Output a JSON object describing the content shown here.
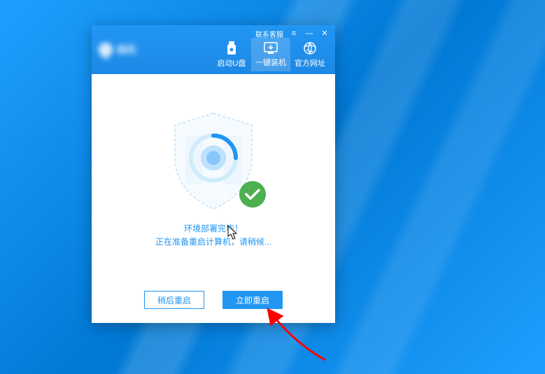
{
  "titlebar": {
    "contact_label": "联系客服"
  },
  "tabs": {
    "usb": "启动U盘",
    "install": "一键装机",
    "website": "官方网址"
  },
  "status": {
    "line1": "环境部署完毕！",
    "line2": "正在准备重启计算机，请稍候..."
  },
  "buttons": {
    "later": "稍后重启",
    "now": "立即重启"
  }
}
